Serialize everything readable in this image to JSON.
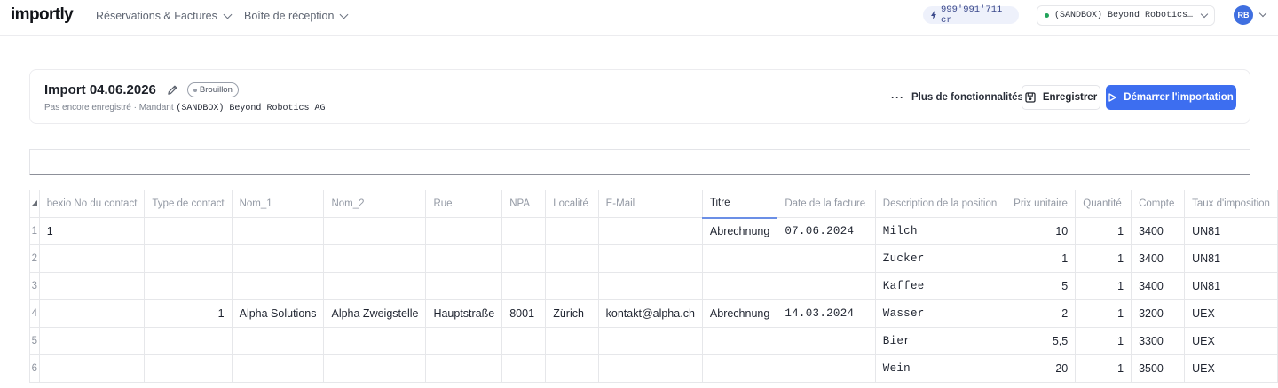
{
  "app": {
    "logo": "importly"
  },
  "nav": {
    "items": [
      {
        "label": "Réservations & Factures"
      },
      {
        "label": "Boîte de réception"
      }
    ],
    "credits": "999'991'711 cr",
    "tenant": "(SANDBOX) Beyond Robotics AG",
    "avatar_initials": "RB"
  },
  "import": {
    "title": "Import 04.06.2026",
    "status_badge": "Brouillon",
    "subtitle_prefix": "Pas encore enregistré · Mandant",
    "mandant": "(SANDBOX) Beyond Robotics AG",
    "more_label": "Plus de fonctionnalités",
    "save_label": "Enregistrer",
    "start_label": "Démarrer l'importation"
  },
  "editor": {
    "value": ""
  },
  "grid": {
    "columns": [
      "bexio No du contact",
      "Type de contact",
      "Nom_1",
      "Nom_2",
      "Rue",
      "NPA",
      "Localité",
      "E-Mail",
      "Titre",
      "Date de la facture",
      "Description de la position",
      "Prix unitaire",
      "Quantité",
      "Compte",
      "Taux d'imposition"
    ],
    "active_column": "Titre",
    "rows": [
      {
        "num": "1",
        "cells": [
          "1",
          "",
          "",
          "",
          "",
          "",
          "",
          "",
          "Abrechnung",
          "07.06.2024",
          "Milch",
          "10",
          "1",
          "3400",
          "UN81"
        ]
      },
      {
        "num": "2",
        "cells": [
          "",
          "",
          "",
          "",
          "",
          "",
          "",
          "",
          "",
          "",
          "Zucker",
          "1",
          "1",
          "3400",
          "UN81"
        ]
      },
      {
        "num": "3",
        "cells": [
          "",
          "",
          "",
          "",
          "",
          "",
          "",
          "",
          "",
          "",
          "Kaffee",
          "5",
          "1",
          "3400",
          "UN81"
        ]
      },
      {
        "num": "4",
        "cells": [
          "",
          "1",
          "Alpha Solutions",
          "Alpha Zweigstelle",
          "Hauptstraße",
          "8001",
          "Zürich",
          "kontakt@alpha.ch",
          "Abrechnung",
          "14.03.2024",
          "Wasser",
          "2",
          "1",
          "3200",
          "UEX"
        ]
      },
      {
        "num": "5",
        "cells": [
          "",
          "",
          "",
          "",
          "",
          "",
          "",
          "",
          "",
          "",
          "Bier",
          "5,5",
          "1",
          "3300",
          "UEX"
        ]
      },
      {
        "num": "6",
        "cells": [
          "",
          "",
          "",
          "",
          "",
          "",
          "",
          "",
          "",
          "",
          "Wein",
          "20",
          "1",
          "3500",
          "UEX"
        ]
      }
    ]
  },
  "colors": {
    "accent": "#3d6ef0",
    "credits_bg": "#eef1fb",
    "tenant_dot": "#22a35a",
    "avatar_bg": "#3f6fe0"
  }
}
